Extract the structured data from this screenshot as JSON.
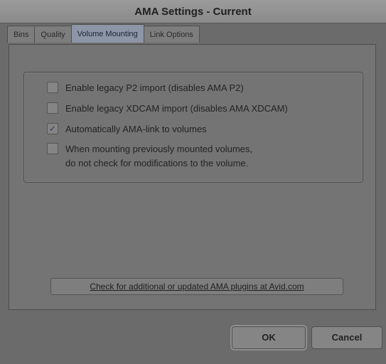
{
  "window": {
    "title": "AMA Settings - Current"
  },
  "tabs": [
    {
      "label": "Bins"
    },
    {
      "label": "Quality"
    },
    {
      "label": "Volume Mounting"
    },
    {
      "label": "Link Options"
    }
  ],
  "active_tab": "Volume Mounting",
  "options": [
    {
      "label_line1": "Enable legacy P2 import (disables AMA P2)",
      "label_line2": "",
      "checked": false
    },
    {
      "label_line1": "Enable legacy XDCAM import (disables AMA XDCAM)",
      "label_line2": "",
      "checked": false
    },
    {
      "label_line1": "Automatically AMA-link to volumes",
      "label_line2": "",
      "checked": true
    },
    {
      "label_line1": "When mounting previously mounted volumes,",
      "label_line2": "do not check for modifications to the volume.",
      "checked": false
    }
  ],
  "check_mark": "✓",
  "plugins_button": {
    "label": "Check for additional or updated AMA plugins at Avid.com"
  },
  "footer": {
    "ok_label": "OK",
    "cancel_label": "Cancel"
  },
  "colors": {
    "active_tab": "#8d96a6",
    "background": "#6b6b6b"
  }
}
